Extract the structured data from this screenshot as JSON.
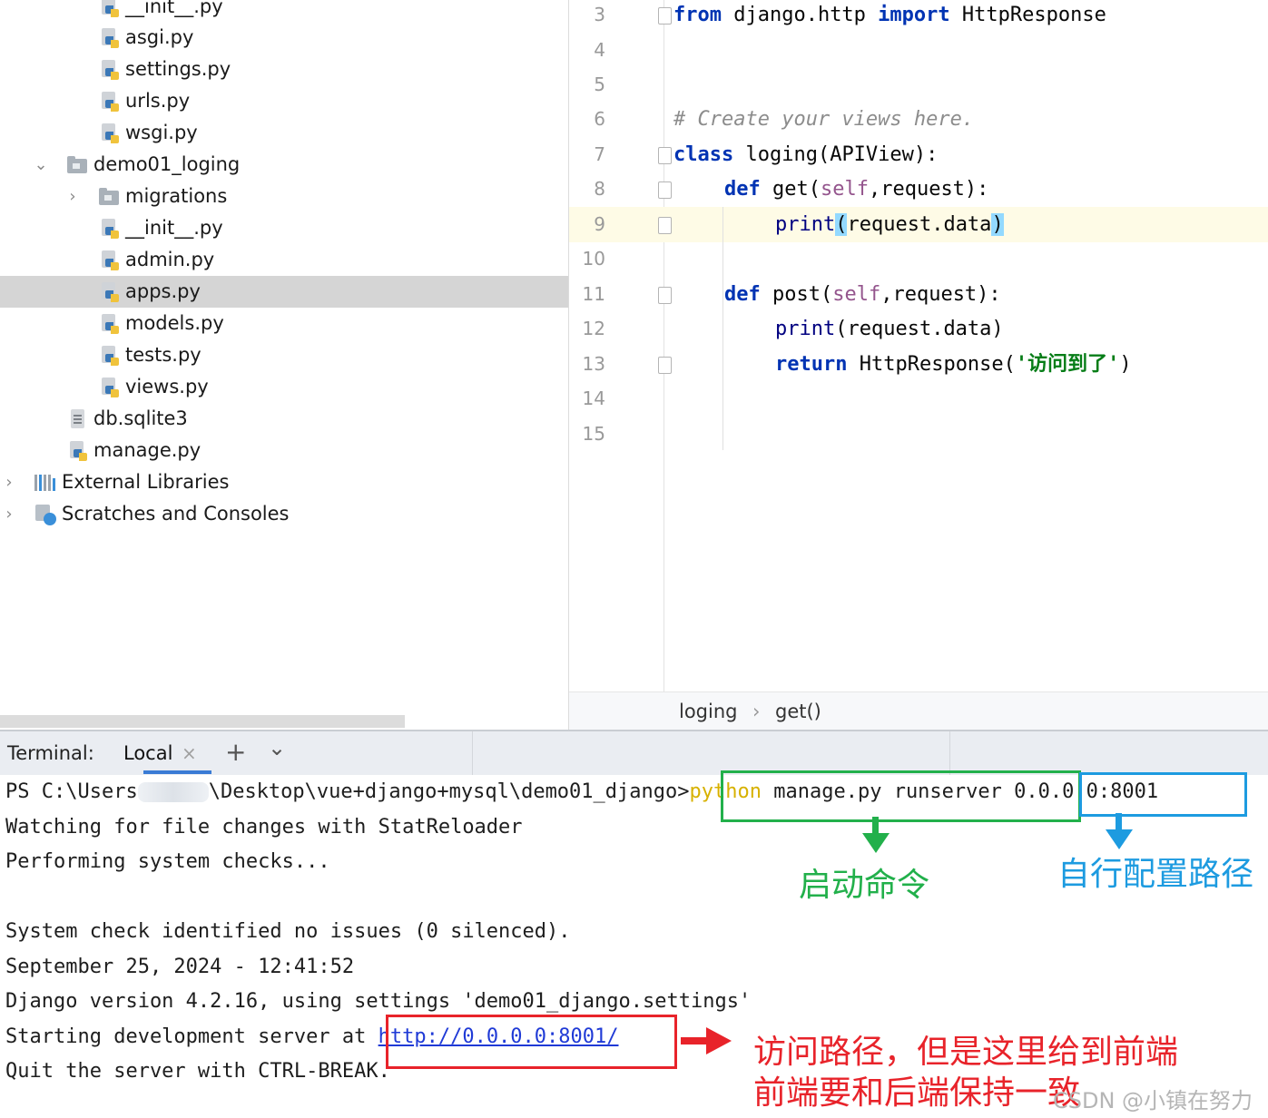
{
  "project_tree": {
    "items": [
      {
        "label": "__init__.py",
        "icon": "python-file-icon",
        "selected": false
      },
      {
        "label": "asgi.py",
        "icon": "python-file-icon",
        "selected": false
      },
      {
        "label": "settings.py",
        "icon": "python-file-icon",
        "selected": false
      },
      {
        "label": "urls.py",
        "icon": "python-file-icon",
        "selected": false
      },
      {
        "label": "wsgi.py",
        "icon": "python-file-icon",
        "selected": false
      },
      {
        "label": "demo01_loging",
        "icon": "folder-icon",
        "selected": false
      },
      {
        "label": "migrations",
        "icon": "folder-icon",
        "selected": false
      },
      {
        "label": "__init__.py",
        "icon": "python-file-icon",
        "selected": false
      },
      {
        "label": "admin.py",
        "icon": "python-file-icon",
        "selected": false
      },
      {
        "label": "apps.py",
        "icon": "python-file-icon",
        "selected": true
      },
      {
        "label": "models.py",
        "icon": "python-file-icon",
        "selected": false
      },
      {
        "label": "tests.py",
        "icon": "python-file-icon",
        "selected": false
      },
      {
        "label": "views.py",
        "icon": "python-file-icon",
        "selected": false
      },
      {
        "label": "db.sqlite3",
        "icon": "database-file-icon",
        "selected": false
      },
      {
        "label": "manage.py",
        "icon": "python-file-icon",
        "selected": false
      },
      {
        "label": "External Libraries",
        "icon": "library-icon",
        "selected": false
      },
      {
        "label": "Scratches and Consoles",
        "icon": "scratches-icon",
        "selected": false
      }
    ]
  },
  "editor": {
    "line_numbers": [
      "3",
      "4",
      "5",
      "6",
      "7",
      "8",
      "9",
      "10",
      "11",
      "12",
      "13",
      "14",
      "15"
    ],
    "code": {
      "l3_kw1": "from",
      "l3_mid": " django.http ",
      "l3_kw2": "import",
      "l3_end": " HttpResponse",
      "l6_comment": "# Create your views here.",
      "l7_kw": "class",
      "l7_rest": " loging(APIView):",
      "l8_kw": "def",
      "l8_name": " get(",
      "l8_self": "self",
      "l8_rest": ",request):",
      "l9_fn": "print",
      "l9_open": "(",
      "l9_mid": "request.data",
      "l9_close": ")",
      "l11_kw": "def",
      "l11_name": " post(",
      "l11_self": "self",
      "l11_rest": ",request):",
      "l12_fn": "print",
      "l12_rest": "(request.data)",
      "l13_kw": "return",
      "l13_mid": " HttpResponse(",
      "l13_str": "'访问到了'",
      "l13_end": ")"
    },
    "breadcrumb": {
      "class_name": "loging",
      "separator": "›",
      "method_name": "get()"
    }
  },
  "terminal": {
    "title": "Terminal:",
    "tab_label": "Local",
    "close_glyph": "×",
    "add_glyph": "+",
    "chevron_glyph": "⌄",
    "prompt_start": "PS C:\\Users",
    "prompt_end": "\\Desktop\\vue+django+mysql\\demo01_django>",
    "cmd_python": "python",
    "cmd_rest": " manage.py runserver ",
    "cmd_addr": "0.0.0.0:8001",
    "lines": [
      "Watching for file changes with StatReloader",
      "Performing system checks...",
      "",
      "System check identified no issues (0 silenced).",
      "September 25, 2024 - 12:41:52",
      "Django version 4.2.16, using settings 'demo01_django.settings'"
    ],
    "start_prefix": "Starting development server at ",
    "server_url": "http://0.0.0.0:8001/",
    "quit_line": "Quit the server with CTRL-BREAK."
  },
  "annotations": {
    "start_command": "启动命令",
    "custom_path": "自行配置路径",
    "access_path_line1": "访问路径，但是这里给到前端",
    "access_path_line2": "前端要和后端保持一致",
    "watermark": "CSDN @小镇在努力",
    "colors": {
      "green": "#22b04b",
      "blue": "#1d9be0",
      "red": "#e8232a"
    }
  }
}
